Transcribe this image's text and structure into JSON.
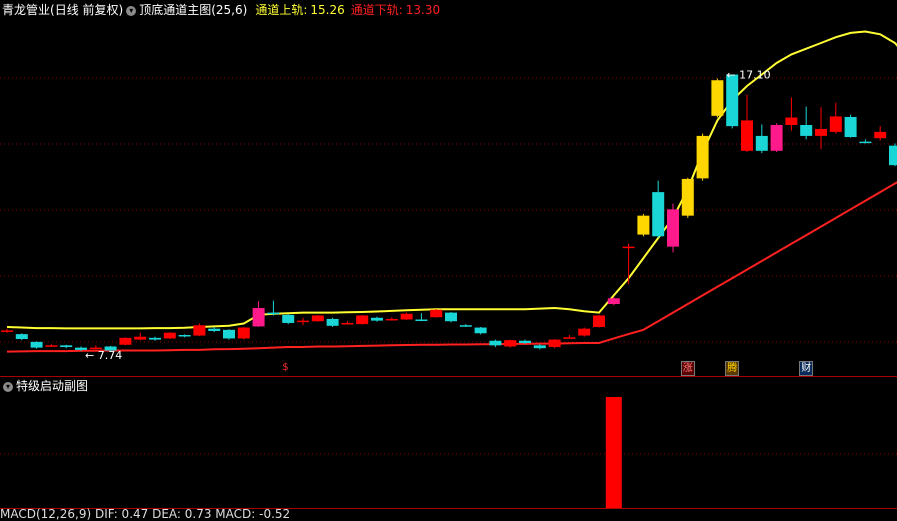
{
  "header": {
    "stock_name": "青龙管业",
    "period": "(日线 前复权)",
    "indicator_name": "顶底通道主图",
    "indicator_params": "(25,6)",
    "upper_label": "通道上轨:",
    "upper_value": "15.26",
    "lower_label": "通道下轨:",
    "lower_value": "13.30"
  },
  "sub_panel": {
    "title": "特级启动副图"
  },
  "bottom_panel": {
    "text": "MACD(12,26,9) DIF: 0.47 DEA: 0.73 MACD: -0.52"
  },
  "annotations": {
    "high_label": "17.10",
    "low_label": "7.74"
  },
  "markers": [
    {
      "label": "$",
      "color": "#ff3030",
      "bg": "#000000",
      "index": 19
    },
    {
      "label": "涨",
      "color": "#ff8080",
      "bg": "#5a0000",
      "index": 46
    },
    {
      "label": "腾",
      "color": "#ffd700",
      "bg": "#5a3a00",
      "index": 49
    },
    {
      "label": "财",
      "color": "#ffffff",
      "bg": "#0a2a5a",
      "index": 54
    }
  ],
  "colors": {
    "up": "#ff0000",
    "down": "#1ad6d6",
    "strong_up": "#ffd700",
    "strong_down": "#ff1a8c",
    "upper_line": "#ffff33",
    "lower_line": "#ff2020",
    "grid": "#8b0000"
  },
  "chart_data": {
    "type": "candlestick",
    "price_range": [
      6.8,
      19.0
    ],
    "candles": [
      {
        "o": 8.18,
        "c": 8.18,
        "h": 8.24,
        "l": 8.1,
        "k": "up"
      },
      {
        "o": 8.05,
        "c": 7.88,
        "h": 8.08,
        "l": 7.84,
        "k": "down"
      },
      {
        "o": 7.78,
        "c": 7.58,
        "h": 7.8,
        "l": 7.54,
        "k": "down"
      },
      {
        "o": 7.66,
        "c": 7.66,
        "h": 7.7,
        "l": 7.62,
        "k": "up"
      },
      {
        "o": 7.66,
        "c": 7.6,
        "h": 7.68,
        "l": 7.56,
        "k": "down"
      },
      {
        "o": 7.58,
        "c": 7.5,
        "h": 7.62,
        "l": 7.46,
        "k": "down"
      },
      {
        "o": 7.58,
        "c": 7.58,
        "h": 7.66,
        "l": 7.52,
        "k": "up"
      },
      {
        "o": 7.48,
        "c": 7.62,
        "h": 7.64,
        "l": 7.44,
        "k": "down"
      },
      {
        "o": 7.68,
        "c": 7.92,
        "h": 7.94,
        "l": 7.66,
        "k": "up"
      },
      {
        "o": 7.86,
        "c": 7.96,
        "h": 8.1,
        "l": 7.84,
        "k": "up"
      },
      {
        "o": 7.92,
        "c": 7.86,
        "h": 7.96,
        "l": 7.82,
        "k": "down"
      },
      {
        "o": 7.9,
        "c": 8.1,
        "h": 8.12,
        "l": 7.88,
        "k": "up"
      },
      {
        "o": 8.02,
        "c": 7.98,
        "h": 8.04,
        "l": 7.94,
        "k": "down"
      },
      {
        "o": 8.0,
        "c": 8.36,
        "h": 8.42,
        "l": 7.98,
        "k": "up"
      },
      {
        "o": 8.24,
        "c": 8.16,
        "h": 8.3,
        "l": 8.12,
        "k": "down"
      },
      {
        "o": 8.2,
        "c": 7.9,
        "h": 8.22,
        "l": 7.86,
        "k": "down"
      },
      {
        "o": 7.9,
        "c": 8.28,
        "h": 8.3,
        "l": 7.86,
        "k": "up"
      },
      {
        "o": 8.32,
        "c": 8.96,
        "h": 9.2,
        "l": 8.3,
        "k": "strong_down"
      },
      {
        "o": 8.8,
        "c": 8.8,
        "h": 9.22,
        "l": 8.7,
        "k": "down"
      },
      {
        "o": 8.72,
        "c": 8.44,
        "h": 8.74,
        "l": 8.4,
        "k": "down"
      },
      {
        "o": 8.52,
        "c": 8.52,
        "h": 8.62,
        "l": 8.36,
        "k": "up"
      },
      {
        "o": 8.5,
        "c": 8.7,
        "h": 8.72,
        "l": 8.48,
        "k": "up"
      },
      {
        "o": 8.58,
        "c": 8.34,
        "h": 8.62,
        "l": 8.3,
        "k": "down"
      },
      {
        "o": 8.44,
        "c": 8.44,
        "h": 8.5,
        "l": 8.38,
        "k": "up"
      },
      {
        "o": 8.4,
        "c": 8.7,
        "h": 8.72,
        "l": 8.38,
        "k": "up"
      },
      {
        "o": 8.62,
        "c": 8.52,
        "h": 8.66,
        "l": 8.48,
        "k": "down"
      },
      {
        "o": 8.58,
        "c": 8.58,
        "h": 8.64,
        "l": 8.52,
        "k": "up"
      },
      {
        "o": 8.56,
        "c": 8.76,
        "h": 8.8,
        "l": 8.54,
        "k": "up"
      },
      {
        "o": 8.56,
        "c": 8.56,
        "h": 8.78,
        "l": 8.5,
        "k": "down"
      },
      {
        "o": 8.64,
        "c": 8.9,
        "h": 8.92,
        "l": 8.62,
        "k": "up"
      },
      {
        "o": 8.8,
        "c": 8.5,
        "h": 8.82,
        "l": 8.46,
        "k": "down"
      },
      {
        "o": 8.36,
        "c": 8.36,
        "h": 8.4,
        "l": 8.3,
        "k": "down"
      },
      {
        "o": 8.28,
        "c": 8.08,
        "h": 8.3,
        "l": 8.04,
        "k": "down"
      },
      {
        "o": 7.82,
        "c": 7.66,
        "h": 7.86,
        "l": 7.6,
        "k": "down"
      },
      {
        "o": 7.62,
        "c": 7.84,
        "h": 7.86,
        "l": 7.58,
        "k": "up"
      },
      {
        "o": 7.82,
        "c": 7.74,
        "h": 7.86,
        "l": 7.7,
        "k": "down"
      },
      {
        "o": 7.66,
        "c": 7.56,
        "h": 7.7,
        "l": 7.52,
        "k": "down"
      },
      {
        "o": 7.6,
        "c": 7.86,
        "h": 7.88,
        "l": 7.56,
        "k": "up"
      },
      {
        "o": 7.94,
        "c": 7.94,
        "h": 8.02,
        "l": 7.9,
        "k": "up"
      },
      {
        "o": 8.0,
        "c": 8.24,
        "h": 8.28,
        "l": 7.96,
        "k": "up"
      },
      {
        "o": 8.3,
        "c": 8.7,
        "h": 8.72,
        "l": 8.28,
        "k": "up"
      },
      {
        "o": 9.1,
        "c": 9.3,
        "h": 9.34,
        "l": 9.06,
        "k": "strong_down"
      },
      {
        "o": 11.1,
        "c": 11.1,
        "h": 11.2,
        "l": 9.8,
        "k": "up"
      },
      {
        "o": 11.52,
        "c": 12.18,
        "h": 12.24,
        "l": 11.46,
        "k": "strong_up"
      },
      {
        "o": 11.46,
        "c": 13.0,
        "h": 13.4,
        "l": 11.4,
        "k": "down"
      },
      {
        "o": 11.1,
        "c": 12.4,
        "h": 12.6,
        "l": 10.9,
        "k": "strong_down"
      },
      {
        "o": 12.18,
        "c": 13.46,
        "h": 13.5,
        "l": 12.1,
        "k": "strong_up"
      },
      {
        "o": 13.48,
        "c": 14.96,
        "h": 15.04,
        "l": 13.4,
        "k": "strong_up"
      },
      {
        "o": 15.66,
        "c": 16.9,
        "h": 16.96,
        "l": 15.6,
        "k": "strong_up"
      },
      {
        "o": 17.1,
        "c": 15.3,
        "h": 17.1,
        "l": 15.22,
        "k": "down"
      },
      {
        "o": 15.5,
        "c": 14.44,
        "h": 16.4,
        "l": 14.4,
        "k": "up"
      },
      {
        "o": 14.44,
        "c": 14.96,
        "h": 15.36,
        "l": 14.36,
        "k": "down"
      },
      {
        "o": 14.44,
        "c": 15.34,
        "h": 15.4,
        "l": 14.4,
        "k": "strong_down"
      },
      {
        "o": 15.34,
        "c": 15.6,
        "h": 16.3,
        "l": 15.14,
        "k": "up"
      },
      {
        "o": 15.34,
        "c": 14.96,
        "h": 15.98,
        "l": 14.84,
        "k": "down"
      },
      {
        "o": 15.2,
        "c": 14.96,
        "h": 15.96,
        "l": 14.5,
        "k": "up"
      },
      {
        "o": 15.64,
        "c": 15.1,
        "h": 16.12,
        "l": 15.04,
        "k": "up"
      },
      {
        "o": 15.62,
        "c": 14.92,
        "h": 15.7,
        "l": 14.9,
        "k": "down"
      },
      {
        "o": 14.76,
        "c": 14.76,
        "h": 14.84,
        "l": 14.7,
        "k": "down"
      },
      {
        "o": 14.88,
        "c": 15.1,
        "h": 15.3,
        "l": 14.8,
        "k": "up"
      },
      {
        "o": 14.62,
        "c": 13.94,
        "h": 14.7,
        "l": 13.9,
        "k": "down"
      },
      {
        "o": 13.7,
        "c": 13.46,
        "h": 13.72,
        "l": 13.4,
        "k": "down"
      }
    ],
    "upper_channel": [
      8.3,
      8.28,
      8.26,
      8.26,
      8.25,
      8.25,
      8.25,
      8.25,
      8.25,
      8.25,
      8.26,
      8.26,
      8.27,
      8.3,
      8.32,
      8.34,
      8.42,
      8.72,
      8.76,
      8.78,
      8.8,
      8.8,
      8.8,
      8.81,
      8.82,
      8.84,
      8.86,
      8.88,
      8.9,
      8.92,
      8.92,
      8.92,
      8.92,
      8.92,
      8.92,
      8.92,
      8.94,
      8.96,
      8.92,
      8.85,
      8.8,
      9.4,
      10.0,
      10.7,
      11.4,
      12.1,
      13.1,
      14.4,
      15.5,
      16.2,
      16.7,
      17.1,
      17.5,
      17.8,
      18.0,
      18.2,
      18.4,
      18.55,
      18.6,
      18.5,
      18.2,
      17.6
    ],
    "lower_channel": [
      7.44,
      7.45,
      7.46,
      7.46,
      7.46,
      7.47,
      7.47,
      7.48,
      7.48,
      7.48,
      7.48,
      7.49,
      7.5,
      7.5,
      7.52,
      7.53,
      7.54,
      7.56,
      7.58,
      7.6,
      7.6,
      7.62,
      7.62,
      7.63,
      7.64,
      7.65,
      7.66,
      7.67,
      7.68,
      7.68,
      7.69,
      7.69,
      7.7,
      7.7,
      7.71,
      7.71,
      7.72,
      7.72,
      7.73,
      7.74,
      7.74,
      7.9,
      8.05,
      8.2,
      8.5,
      8.8,
      9.1,
      9.4,
      9.7,
      10.0,
      10.3,
      10.6,
      10.9,
      11.2,
      11.5,
      11.8,
      12.1,
      12.4,
      12.7,
      13.0,
      13.3,
      13.6
    ],
    "sub_bars": [
      {
        "index": 41,
        "value": 1
      }
    ]
  }
}
